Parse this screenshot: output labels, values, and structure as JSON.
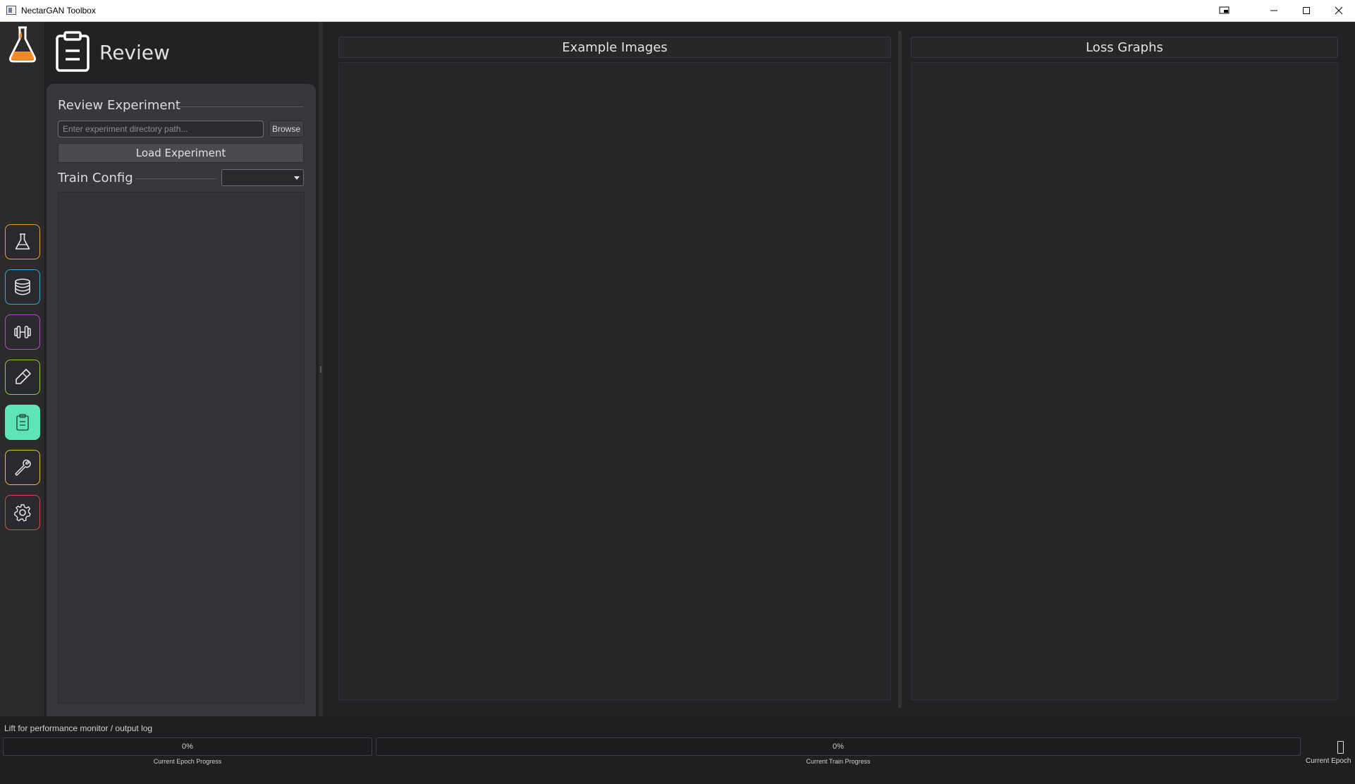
{
  "window": {
    "title": "NectarGAN Toolbox"
  },
  "sidebar": {
    "items": [
      {
        "icon": "flask-icon",
        "color": "#e8a23a",
        "selected": false
      },
      {
        "icon": "database-icon",
        "color": "#3aa8d8",
        "selected": false
      },
      {
        "icon": "dumbbell-icon",
        "color": "#b04cc8",
        "selected": false
      },
      {
        "icon": "eraser-icon",
        "color": "#9ac83a",
        "selected": false
      },
      {
        "icon": "clipboard-icon",
        "color": "#5fe3b8",
        "selected": true
      },
      {
        "icon": "wrench-icon",
        "color": "#e0c03a",
        "selected": false
      },
      {
        "icon": "gear-icon",
        "color": "#d84a4a",
        "selected": false
      }
    ]
  },
  "page": {
    "title": "Review",
    "icon": "clipboard-icon"
  },
  "review": {
    "section_title": "Review Experiment",
    "path_placeholder": "Enter experiment directory path...",
    "path_value": "",
    "browse_label": "Browse",
    "load_label": "Load Experiment"
  },
  "train_config": {
    "section_title": "Train Config",
    "selected": ""
  },
  "panels": {
    "example_images_title": "Example Images",
    "loss_graphs_title": "Loss Graphs"
  },
  "status": {
    "log_hint": "Lift for performance monitor / output log",
    "epoch_progress_value": 0,
    "epoch_progress_text": "0%",
    "epoch_progress_label": "Current Epoch Progress",
    "train_progress_value": 0,
    "train_progress_text": "0%",
    "train_progress_label": "Current Train Progress",
    "current_epoch_label": "Current Epoch"
  },
  "colors": {
    "accent": "#5fe3b8",
    "background": "#222224",
    "panel": "#38383c"
  }
}
